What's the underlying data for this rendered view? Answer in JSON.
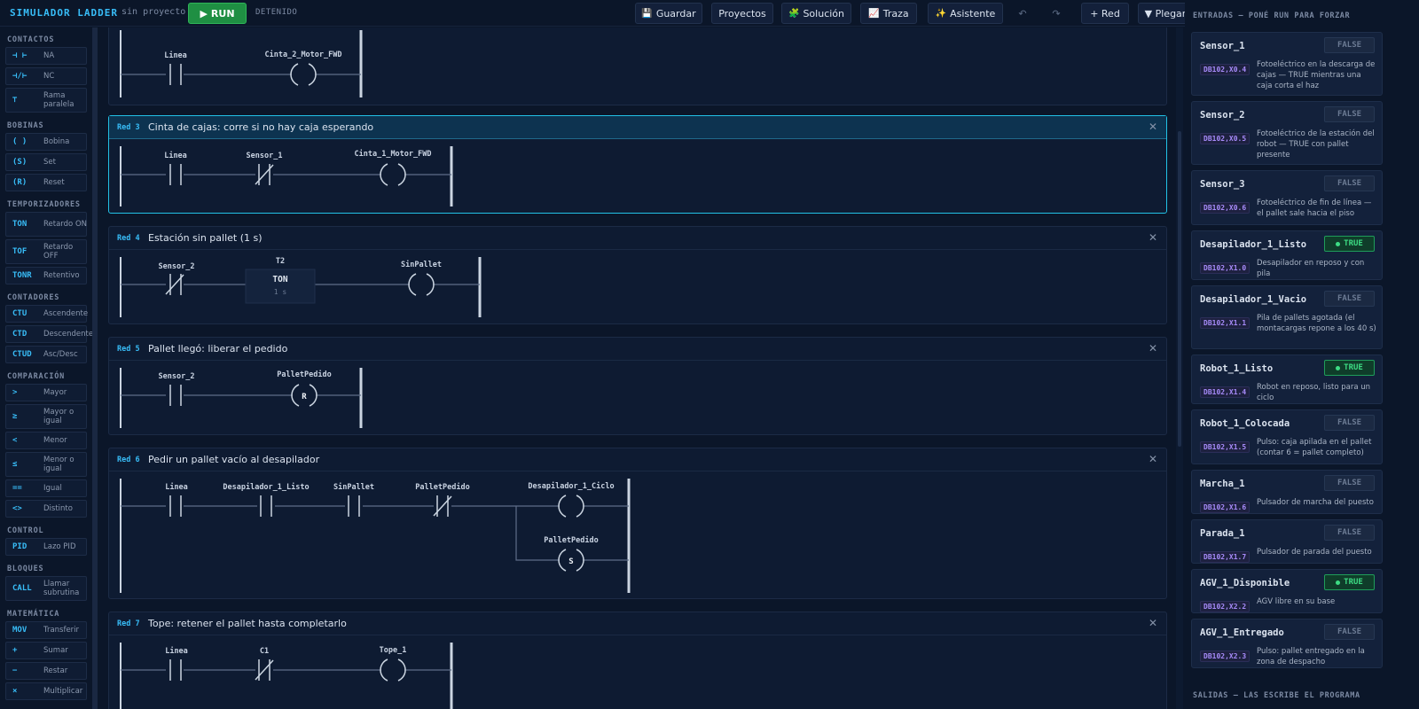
{
  "app": {
    "title": "SIMULADOR LADDER",
    "project": "sin proyecto",
    "status": "DETENIDO"
  },
  "toolbar": {
    "run_label": "RUN",
    "save_label": "Guardar",
    "projects_label": "Proyectos",
    "solution_label": "Solución",
    "trace_label": "Traza",
    "assistant_label": "Asistente",
    "undo_symbol": "↶",
    "redo_symbol": "↷",
    "add_rung_label": "+ Red",
    "collapse_label": "▼ Plegar",
    "icons": {
      "run": "play-icon",
      "save": "floppy-icon",
      "solution": "puzzle-icon",
      "trace": "chart-icon",
      "assistant": "sparkles-icon"
    }
  },
  "palette": {
    "sections": [
      {
        "title": "CONTACTOS",
        "items": [
          {
            "sym": "⊣ ⊢",
            "label": "NA"
          },
          {
            "sym": "⊣/⊢",
            "label": "NC"
          },
          {
            "sym": "⊤",
            "label": "Rama paralela"
          }
        ]
      },
      {
        "title": "BOBINAS",
        "items": [
          {
            "sym": "( )",
            "label": "Bobina"
          },
          {
            "sym": "(S)",
            "label": "Set"
          },
          {
            "sym": "(R)",
            "label": "Reset"
          }
        ]
      },
      {
        "title": "TEMPORIZADORES",
        "items": [
          {
            "sym": "TON",
            "label": "Retardo ON"
          },
          {
            "sym": "TOF",
            "label": "Retardo OFF"
          },
          {
            "sym": "TONR",
            "label": "Retentivo"
          }
        ]
      },
      {
        "title": "CONTADORES",
        "items": [
          {
            "sym": "CTU",
            "label": "Ascendente"
          },
          {
            "sym": "CTD",
            "label": "Descendente"
          },
          {
            "sym": "CTUD",
            "label": "Asc/Desc"
          }
        ]
      },
      {
        "title": "COMPARACIÓN",
        "items": [
          {
            "sym": ">",
            "label": "Mayor"
          },
          {
            "sym": "≥",
            "label": "Mayor o igual"
          },
          {
            "sym": "<",
            "label": "Menor"
          },
          {
            "sym": "≤",
            "label": "Menor o igual"
          },
          {
            "sym": "==",
            "label": "Igual"
          },
          {
            "sym": "<>",
            "label": "Distinto"
          }
        ]
      },
      {
        "title": "CONTROL",
        "items": [
          {
            "sym": "PID",
            "label": "Lazo PID"
          }
        ]
      },
      {
        "title": "BLOQUES",
        "items": [
          {
            "sym": "CALL",
            "label": "Llamar subrutina"
          }
        ]
      },
      {
        "title": "MATEMÁTICA",
        "items": [
          {
            "sym": "MOV",
            "label": "Transferir"
          },
          {
            "sym": "+",
            "label": "Sumar"
          },
          {
            "sym": "−",
            "label": "Restar"
          },
          {
            "sym": "×",
            "label": "Multiplicar"
          }
        ]
      }
    ]
  },
  "rungs": [
    {
      "num": "",
      "title": "",
      "labels": [
        "Linea",
        "Cinta_2_Motor_FWD"
      ]
    },
    {
      "num": "Red 3",
      "title": "Cinta de cajas: corre si no hay caja esperando",
      "labels": [
        "Linea",
        "Sensor_1",
        "Cinta_1_Motor_FWD"
      ]
    },
    {
      "num": "Red 4",
      "title": "Estación sin pallet (1 s)",
      "labels": [
        "Sensor_2",
        "T2",
        "TON",
        "1 s",
        "SinPallet"
      ]
    },
    {
      "num": "Red 5",
      "title": "Pallet llegó: liberar el pedido",
      "labels": [
        "Sensor_2",
        "PalletPedido",
        "R"
      ]
    },
    {
      "num": "Red 6",
      "title": "Pedir un pallet vacío al desapilador",
      "labels": [
        "Linea",
        "Desapilador_1_Listo",
        "SinPallet",
        "PalletPedido",
        "Desapilador_1_Ciclo",
        "PalletPedido",
        "S"
      ]
    },
    {
      "num": "Red 7",
      "title": "Tope: retener el pallet hasta completarlo",
      "labels": [
        "Linea",
        "C1",
        "Tope_1"
      ]
    }
  ],
  "io": {
    "inputs_title": "ENTRADAS — PONÉ RUN PARA FORZAR",
    "outputs_title": "SALIDAS — LAS ESCRIBE EL PROGRAMA",
    "inputs": [
      {
        "name": "Sensor_1",
        "value": "FALSE",
        "addr": "DB102,X0.4",
        "desc": "Fotoeléctrico en la descarga de cajas — TRUE mientras una caja corta el haz"
      },
      {
        "name": "Sensor_2",
        "value": "FALSE",
        "addr": "DB102,X0.5",
        "desc": "Fotoeléctrico de la estación del robot — TRUE con pallet presente"
      },
      {
        "name": "Sensor_3",
        "value": "FALSE",
        "addr": "DB102,X0.6",
        "desc": "Fotoeléctrico de fin de línea — el pallet sale hacia el piso"
      },
      {
        "name": "Desapilador_1_Listo",
        "value": "TRUE",
        "addr": "DB102,X1.0",
        "desc": "Desapilador en reposo y con pila"
      },
      {
        "name": "Desapilador_1_Vacio",
        "value": "FALSE",
        "addr": "DB102,X1.1",
        "desc": "Pila de pallets agotada (el montacargas repone a los 40 s)"
      },
      {
        "name": "Robot_1_Listo",
        "value": "TRUE",
        "addr": "DB102,X1.4",
        "desc": "Robot en reposo, listo para un ciclo"
      },
      {
        "name": "Robot_1_Colocada",
        "value": "FALSE",
        "addr": "DB102,X1.5",
        "desc": "Pulso: caja apilada en el pallet (contar 6 = pallet completo)"
      },
      {
        "name": "Marcha_1",
        "value": "FALSE",
        "addr": "DB102,X1.6",
        "desc": "Pulsador de marcha del puesto"
      },
      {
        "name": "Parada_1",
        "value": "FALSE",
        "addr": "DB102,X1.7",
        "desc": "Pulsador de parada del puesto"
      },
      {
        "name": "AGV_1_Disponible",
        "value": "TRUE",
        "addr": "DB102,X2.2",
        "desc": "AGV libre en su base"
      },
      {
        "name": "AGV_1_Entregado",
        "value": "FALSE",
        "addr": "DB102,X2.3",
        "desc": "Pulso: pallet entregado en la zona de despacho"
      }
    ]
  },
  "colors": {
    "accent": "#38bdf8",
    "run": "#1f8f43",
    "true": "#3ddc84",
    "address": "#a78bfa",
    "selected": "#22c2e6"
  }
}
